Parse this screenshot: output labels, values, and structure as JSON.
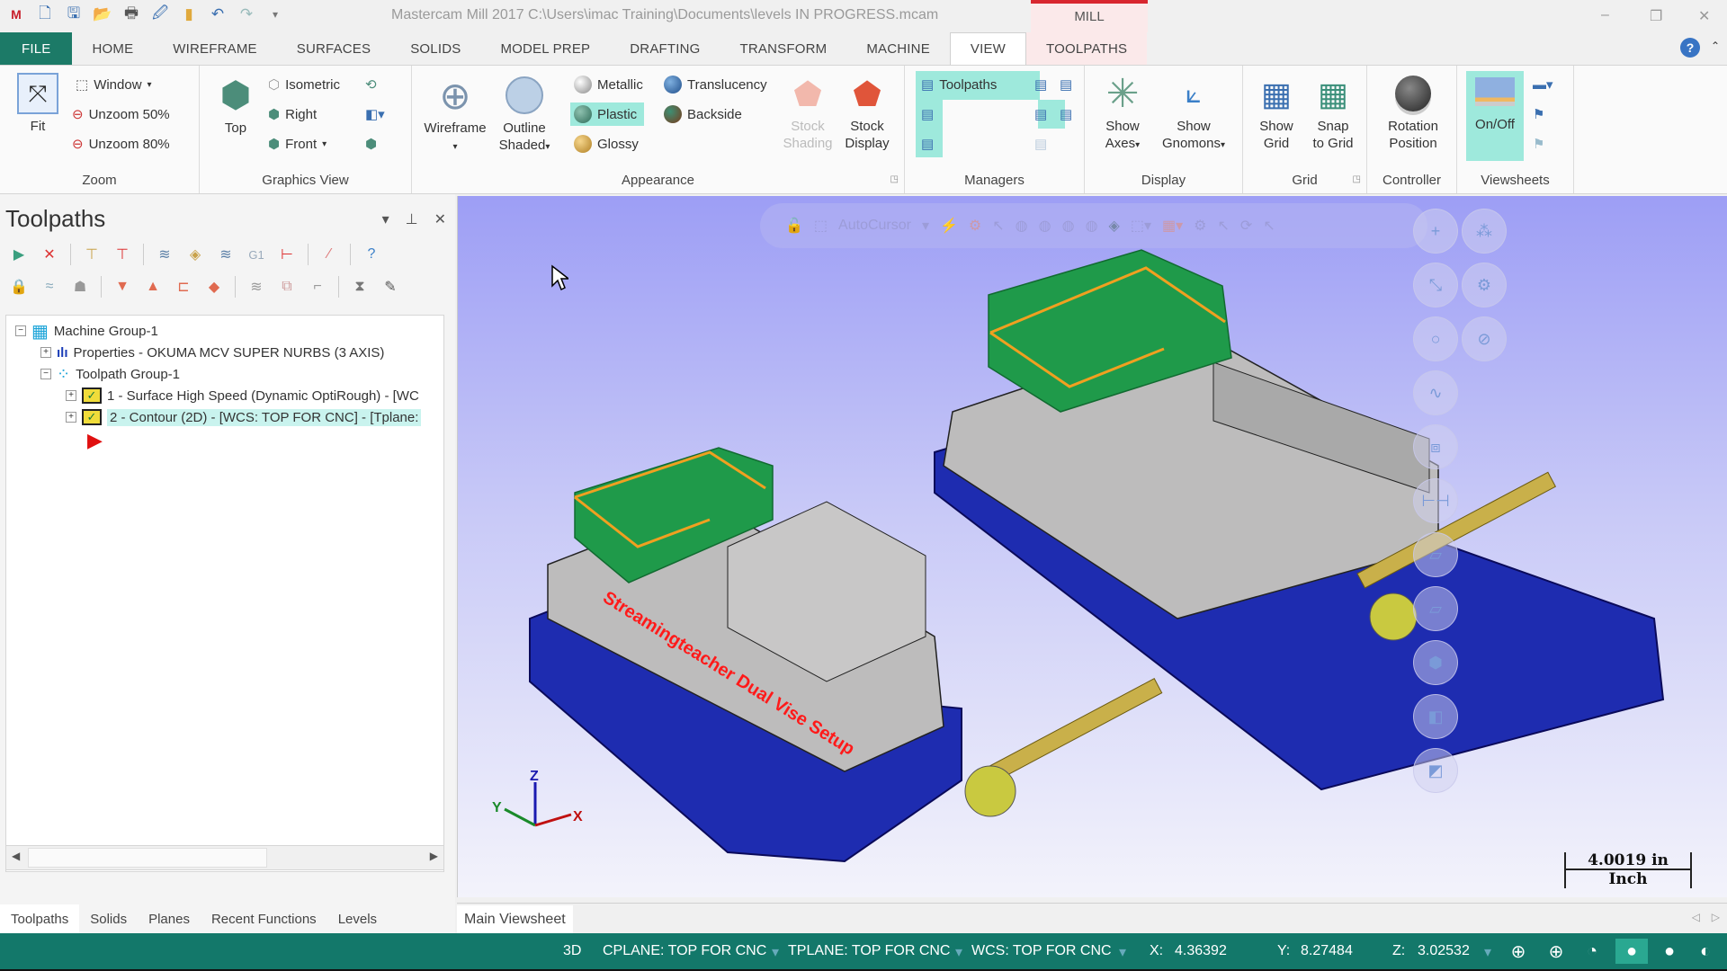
{
  "titlebar": {
    "title": "Mastercam Mill 2017  C:\\Users\\imac Training\\Documents\\levels IN PROGRESS.mcam",
    "context_tab": "MILL",
    "quick_access": [
      "mastercam-logo",
      "new-file",
      "save",
      "open",
      "print",
      "save-as",
      "folder",
      "undo",
      "redo",
      "customize"
    ],
    "min": "–",
    "max": "❐",
    "close": "✕"
  },
  "tabs": [
    "FILE",
    "HOME",
    "WIREFRAME",
    "SURFACES",
    "SOLIDS",
    "MODEL PREP",
    "DRAFTING",
    "TRANSFORM",
    "MACHINE",
    "VIEW",
    "TOOLPATHS"
  ],
  "active_tab": "VIEW",
  "ribbon": {
    "zoom": {
      "label": "Zoom",
      "fit": "Fit",
      "window": "Window",
      "unzoom50": "Unzoom 50%",
      "unzoom80": "Unzoom 80%"
    },
    "graphics_view": {
      "label": "Graphics View",
      "top": "Top",
      "isometric": "Isometric",
      "right": "Right",
      "front": "Front"
    },
    "appearance": {
      "label": "Appearance",
      "wireframe": "Wireframe",
      "outline_shaded": [
        "Outline",
        "Shaded"
      ],
      "metallic": "Metallic",
      "plastic": "Plastic",
      "glossy": "Glossy",
      "translucency": "Translucency",
      "backside": "Backside",
      "stock_shading": [
        "Stock",
        "Shading"
      ],
      "stock_display": [
        "Stock",
        "Display"
      ]
    },
    "managers": {
      "label": "Managers",
      "toolpaths": "Toolpaths"
    },
    "display": {
      "label": "Display",
      "show_axes": [
        "Show",
        "Axes"
      ],
      "show_gnomons": [
        "Show",
        "Gnomons"
      ]
    },
    "grid": {
      "label": "Grid",
      "show_grid": [
        "Show",
        "Grid"
      ],
      "snap_to_grid": [
        "Snap",
        "to Grid"
      ]
    },
    "controller": {
      "label": "Controller",
      "rotation_position": [
        "Rotation",
        "Position"
      ]
    },
    "viewsheets": {
      "label": "Viewsheets",
      "onoff": "On/Off"
    }
  },
  "panel": {
    "title": "Toolpaths",
    "toolbar_row1": [
      "select-all-ops",
      "select-all-dirty",
      "regenerate-selected",
      "regenerate-dirty",
      "backplot",
      "verify",
      "simulate",
      "g1",
      "post",
      "highfeed",
      "help"
    ],
    "toolbar_row2": [
      "lock",
      "toggle-display",
      "toggle-posting",
      "move-down",
      "move-up",
      "insert-arrow",
      "scroll",
      "select-tool",
      "select-op",
      "toolpath-filter",
      "machine-sim",
      "edit-op"
    ],
    "tree": [
      {
        "label": "Machine Group-1",
        "icon": "machine-group"
      },
      {
        "label": "Properties - OKUMA MCV SUPER NURBS (3 AXIS)",
        "icon": "properties"
      },
      {
        "label": "Toolpath Group-1",
        "icon": "toolpath-group"
      },
      {
        "label": "1 - Surface High Speed (Dynamic OptiRough) - [WC",
        "icon": "operation"
      },
      {
        "label": "2 - Contour (2D) - [WCS: TOP FOR CNC] - [Tplane:",
        "icon": "operation",
        "selected": true
      }
    ],
    "bottom_tabs": [
      "Toolpaths",
      "Solids",
      "Planes",
      "Recent Functions",
      "Levels"
    ],
    "active_bottom_tab": "Toolpaths"
  },
  "viewport": {
    "autocursor_label": "AutoCursor",
    "model_text": "Streamingteacher Dual Vise Setup",
    "gnomon": {
      "x": "X",
      "y": "Y",
      "z": "Z"
    },
    "scale": {
      "value": "4.0019 in",
      "unit": "Inch"
    },
    "viewsheet_tab": "Main Viewsheet"
  },
  "status": {
    "mode": "3D",
    "cplane": "CPLANE: TOP FOR CNC",
    "tplane": "TPLANE: TOP FOR CNC",
    "wcs": "WCS: TOP FOR CNC",
    "x_label": "X:",
    "x": "4.36392",
    "y_label": "Y:",
    "y": "8.27484",
    "z_label": "Z:",
    "z": "3.02532"
  }
}
